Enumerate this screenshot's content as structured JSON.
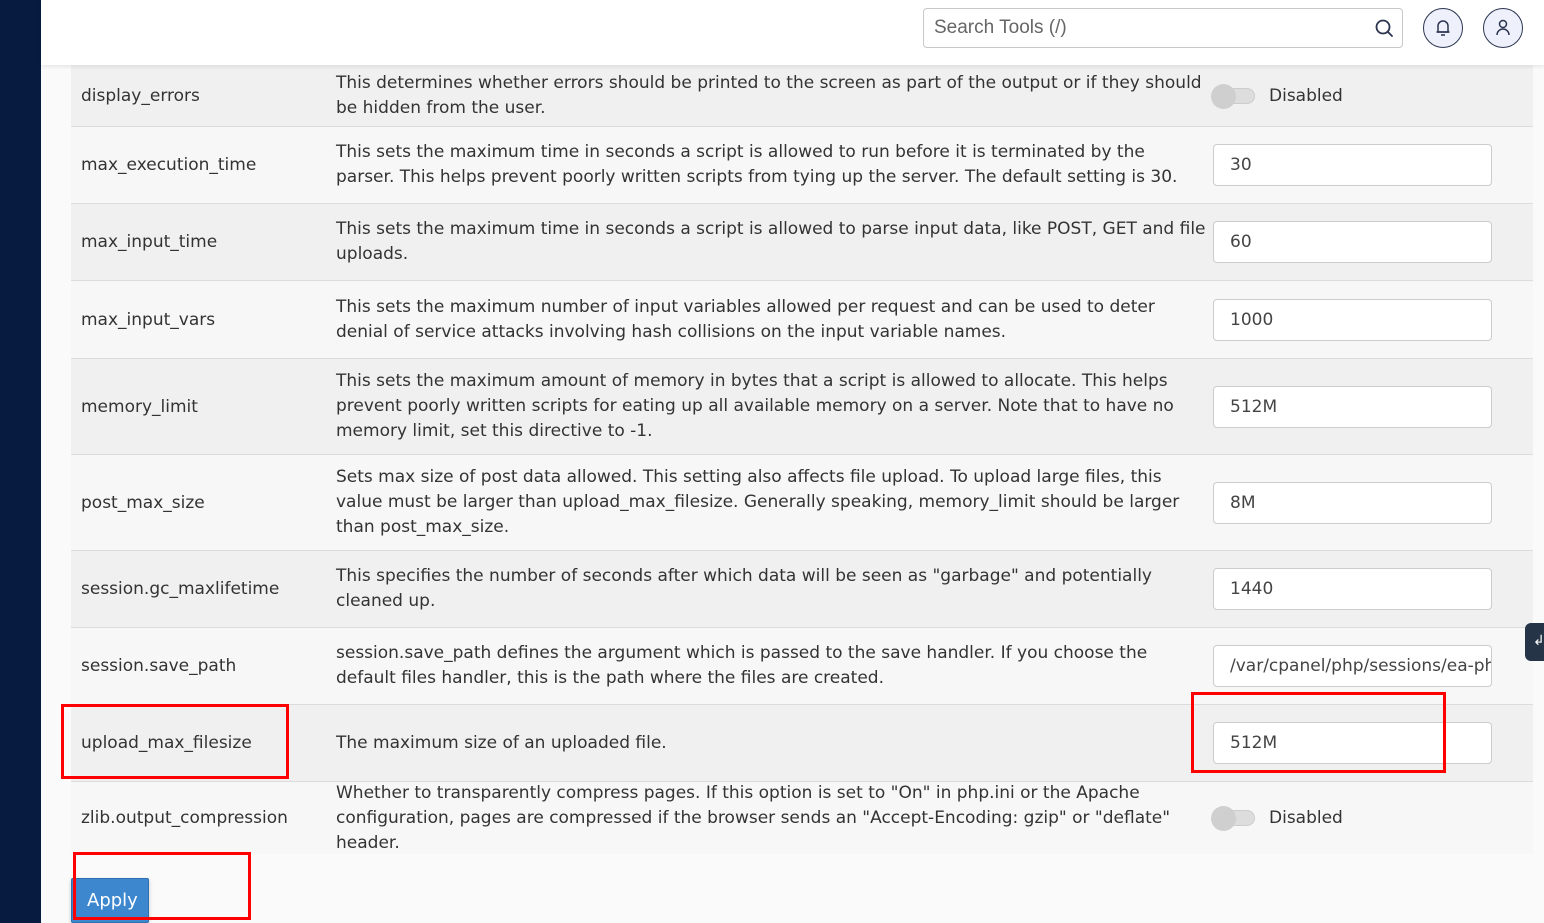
{
  "header": {
    "search_placeholder": "Search Tools (/)",
    "icons": {
      "search": "search-icon",
      "notifications": "bell-icon",
      "account": "user-icon"
    }
  },
  "directives": [
    {
      "name": "display_errors",
      "description": "This determines whether errors should be printed to the screen as part of the output or if they should be hidden from the user.",
      "control": "toggle",
      "value": "Disabled"
    },
    {
      "name": "max_execution_time",
      "description": "This sets the maximum time in seconds a script is allowed to run before it is terminated by the parser. This helps prevent poorly written scripts from tying up the server. The default setting is 30.",
      "control": "input",
      "value": "30"
    },
    {
      "name": "max_input_time",
      "description": "This sets the maximum time in seconds a script is allowed to parse input data, like POST, GET and file uploads.",
      "control": "input",
      "value": "60"
    },
    {
      "name": "max_input_vars",
      "description": "This sets the maximum number of input variables allowed per request and can be used to deter denial of service attacks involving hash collisions on the input variable names.",
      "control": "input",
      "value": "1000"
    },
    {
      "name": "memory_limit",
      "description": "This sets the maximum amount of memory in bytes that a script is allowed to allocate. This helps prevent poorly written scripts for eating up all available memory on a server. Note that to have no memory limit, set this directive to -1.",
      "control": "input",
      "value": "512M"
    },
    {
      "name": "post_max_size",
      "description": "Sets max size of post data allowed. This setting also affects file upload. To upload large files, this value must be larger than upload_max_filesize. Generally speaking, memory_limit should be larger than post_max_size.",
      "control": "input",
      "value": "8M"
    },
    {
      "name": "session.gc_maxlifetime",
      "description": "This specifies the number of seconds after which data will be seen as \"garbage\" and potentially cleaned up.",
      "control": "input",
      "value": "1440"
    },
    {
      "name": "session.save_path",
      "description": "session.save_path defines the argument which is passed to the save handler. If you choose the default files handler, this is the path where the files are created.",
      "control": "input",
      "value": "/var/cpanel/php/sessions/ea-php"
    },
    {
      "name": "upload_max_filesize",
      "description": "The maximum size of an uploaded file.",
      "control": "input",
      "value": "512M"
    },
    {
      "name": "zlib.output_compression",
      "description": "Whether to transparently compress pages. If this option is set to \"On\" in php.ini or the Apache configuration, pages are compressed if the browser sends an \"Accept-Encoding: gzip\" or \"deflate\" header.",
      "control": "toggle",
      "value": "Disabled"
    }
  ],
  "actions": {
    "apply_label": "Apply"
  },
  "colors": {
    "sidebar": "#061b3f",
    "apply_button": "#3d87cf",
    "highlight": "#ff0000"
  }
}
